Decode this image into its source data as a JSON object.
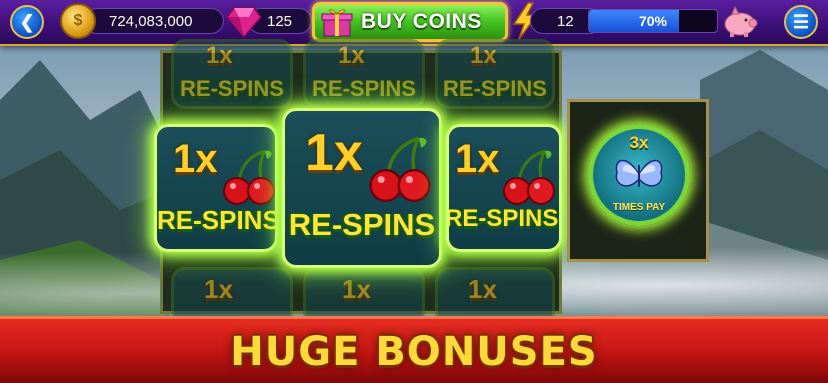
{
  "top_bar": {
    "back_icon": "chevron-left-icon",
    "coins": "724,083,000",
    "coin_icon": "gold-coin-icon",
    "gems": "125",
    "gem_icon": "pink-gem-icon",
    "buy_coins_label": "BUY COINS",
    "gift_icon": "gift-box-icon",
    "level": "12",
    "level_icon": "lightning-bolt-icon",
    "xp_progress_percent": 70,
    "xp_progress_label": "70%",
    "piggy_bank_icon": "piggy-bank-icon",
    "menu_icon": "hamburger-menu-icon"
  },
  "reels": {
    "tiles_top_row": [
      {
        "multiplier": "1x",
        "label": "RE-SPINS"
      },
      {
        "multiplier": "1x",
        "label": "RE-SPINS"
      },
      {
        "multiplier": "1x",
        "label": "RE-SPINS"
      }
    ],
    "tiles_middle_row": [
      {
        "multiplier": "1x",
        "label": "RE-SPINS"
      },
      {
        "multiplier": "1x",
        "label": "RE-SPINS"
      },
      {
        "multiplier": "1x",
        "label": "RE-SPINS"
      }
    ],
    "tiles_bottom_row": [
      {
        "multiplier": "1x"
      },
      {
        "multiplier": "1x"
      },
      {
        "multiplier": "1x"
      }
    ],
    "bonus_symbol": {
      "multiplier": "3x",
      "label": "TIMES PAY",
      "icon": "butterfly-icon"
    }
  },
  "banner": {
    "text": "HUGE BONUSES"
  },
  "colors": {
    "accent_gold": "#f2c436",
    "buy_green": "#43c21f",
    "banner_red": "#c01412",
    "glow_green": "#b8ff4a"
  }
}
